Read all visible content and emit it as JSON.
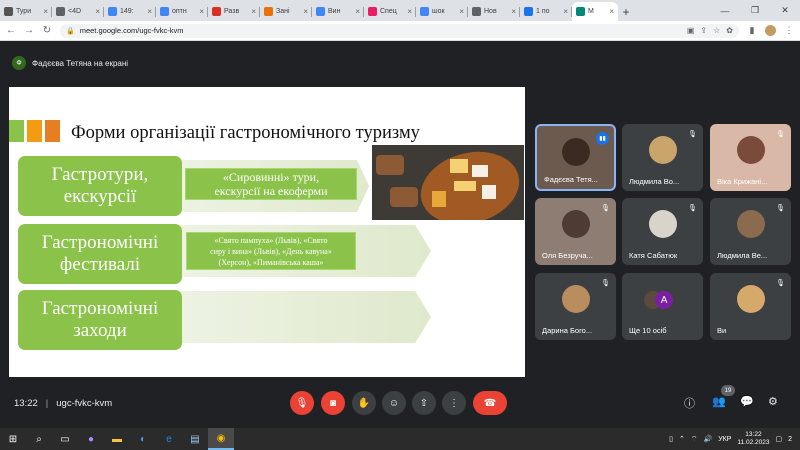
{
  "browser": {
    "tabs": [
      {
        "label": "Тури",
        "color": "#555555"
      },
      {
        "label": "<4D",
        "color": "#5f6368"
      },
      {
        "label": "149:",
        "color": "#4285f4"
      },
      {
        "label": "оптн",
        "color": "#4285f4"
      },
      {
        "label": "Разв",
        "color": "#d93025"
      },
      {
        "label": "Зані",
        "color": "#e8710a"
      },
      {
        "label": "Вин",
        "color": "#4285f4"
      },
      {
        "label": "Спец",
        "color": "#e91e63"
      },
      {
        "label": "шок",
        "color": "#4285f4"
      },
      {
        "label": "Нов",
        "color": "#5f6368"
      },
      {
        "label": "1 по",
        "color": "#1a73e8"
      },
      {
        "label": "M",
        "color": "#00897b"
      }
    ],
    "new_tab": "+",
    "window_controls": [
      "—",
      "❐",
      "✕"
    ],
    "url": "meet.google.com/ugc-fvkc-kvm"
  },
  "meet": {
    "presenter_chip": {
      "avatar_letter": "Ф",
      "text": "Фадєєва Тетяна на екрані"
    },
    "meeting_time": "13:22",
    "meeting_code": "ugc-fvkc-kvm",
    "participants_badge": "19",
    "tiles": [
      {
        "name": "Фадєєва Тетя...",
        "speaking": true,
        "bg": "#6b5a4d",
        "avatar": "#3a2a22"
      },
      {
        "name": "Людмила Во...",
        "speaking": false,
        "bg": "#3c4043",
        "avatar": "#c9a46b"
      },
      {
        "name": "Віка Крижані...",
        "speaking": false,
        "bg": "#d9b8a8",
        "avatar": "#7a4a3a"
      },
      {
        "name": "Оля Безручa...",
        "speaking": false,
        "bg": "#8e7d72",
        "avatar": "#4e3b33"
      },
      {
        "name": "Катя Сабатюк",
        "speaking": false,
        "bg": "#3c4043",
        "avatar": "#d9d4c9"
      },
      {
        "name": "Людмила Ве...",
        "speaking": false,
        "bg": "#3c4043",
        "avatar": "#8b6b4d"
      },
      {
        "name": "Дарина Бого...",
        "speaking": false,
        "bg": "#3c4043",
        "avatar": "#b98d5e"
      },
      {
        "name": "Ще 10 осіб",
        "speaking": false,
        "bg": "#3c4043",
        "avatar": "#7b1fa2",
        "letter": "A"
      },
      {
        "name": "Ви",
        "speaking": false,
        "bg": "#3c4043",
        "avatar": "#d4a96a"
      }
    ]
  },
  "slide": {
    "title": "Форми організації гастрономічного туризму",
    "bar_colors": [
      "#8bc34a",
      "#f39c12",
      "#e67e22"
    ],
    "rows": [
      {
        "box_line1": "Гастротури,",
        "box_line2": "екскурсії",
        "note_lines": [
          "«Сировинні» тури,",
          "екскурсії на екоферми"
        ]
      },
      {
        "box_line1": "Гастрономічні",
        "box_line2": "фестивалі",
        "note_lines": [
          "«Свято пампуха» (Львів), «Свято",
          "сиру і вина» (Львів), «День кавуна»",
          "(Херсон), «Пиманівська каша»"
        ]
      },
      {
        "box_line1": "Гастрономічні",
        "box_line2": "заходи",
        "note_lines": []
      }
    ]
  },
  "taskbar": {
    "lang": "УКР",
    "time": "13:22",
    "date": "11.02.2023",
    "notifications": "2"
  },
  "colors": {
    "meet_bg": "#202124",
    "end_call": "#ea4335",
    "accent_green": "#8bc34a"
  }
}
